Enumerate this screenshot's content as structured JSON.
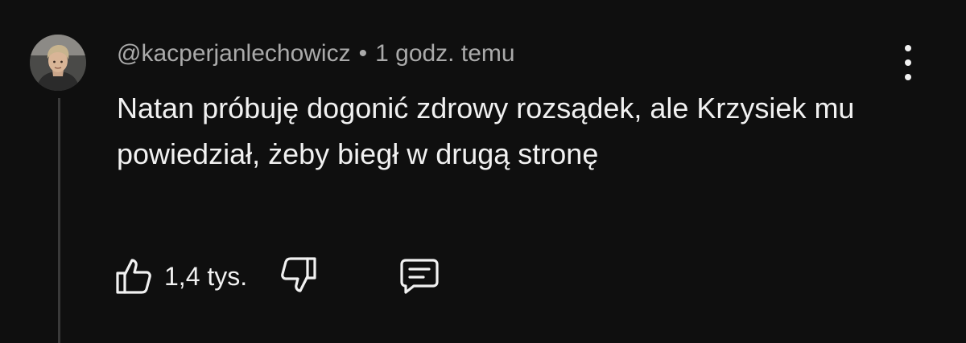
{
  "comment": {
    "username": "@kacperjanlechowicz",
    "separator": "•",
    "timestamp": "1 godz. temu",
    "text": "Natan próbuję dogonić zdrowy rozsądek, ale Krzysiek mu powiedział, żeby biegł w drugą stronę",
    "like_count": "1,4 tys."
  },
  "icons": {
    "avatar": "avatar",
    "more": "more-vertical-icon",
    "like": "thumbs-up-icon",
    "dislike": "thumbs-down-icon",
    "reply": "comment-icon"
  },
  "colors": {
    "background": "#0f0f0f",
    "primary_text": "#f1f1f1",
    "secondary_text": "#aaaaaa",
    "thread_line": "#3a3a3a"
  }
}
